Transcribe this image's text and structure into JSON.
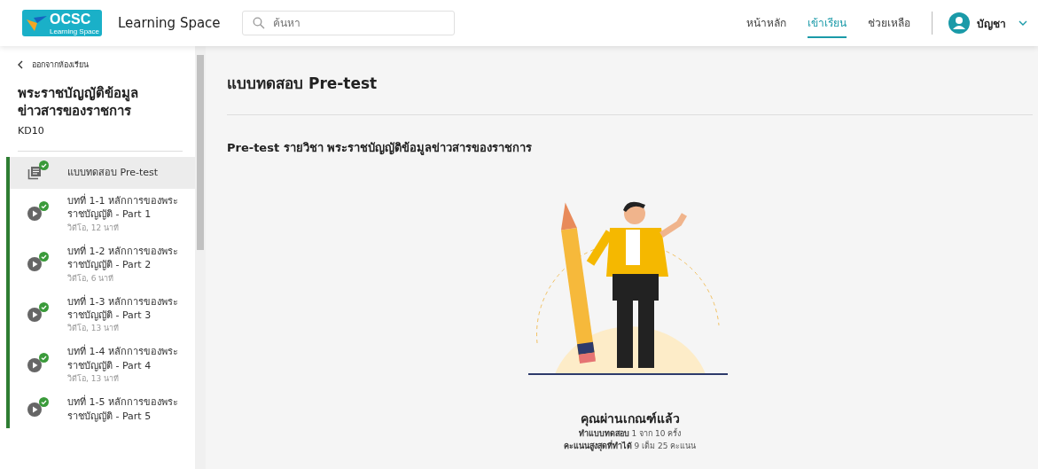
{
  "header": {
    "logo": {
      "title": "OCSC",
      "subtitle": "Learning Space"
    },
    "app_name": "Learning Space",
    "search": {
      "placeholder": "ค้นหา"
    },
    "nav": [
      {
        "label": "หน้าหลัก",
        "selected": false
      },
      {
        "label": "เข้าเรียน",
        "selected": true
      },
      {
        "label": "ช่วยเหลือ",
        "selected": false
      }
    ],
    "user": {
      "name": "บัญชา"
    }
  },
  "sidebar": {
    "back_link": "ออกจากห้องเรียน",
    "course_title": "พระราชบัญญัติข้อมูลข่าวสารของราชการ",
    "course_code": "KD10",
    "items": [
      {
        "kind": "quiz",
        "title": "แบบทดสอบ Pre-test",
        "completed": true,
        "selected": true
      },
      {
        "kind": "video",
        "title": "บทที่ 1-1 หลักการของพระราชบัญญัติ - Part 1",
        "meta": "วิดีโอ, 12 นาที",
        "completed": true,
        "selected": false
      },
      {
        "kind": "video",
        "title": "บทที่ 1-2 หลักการของพระราชบัญญัติ - Part 2",
        "meta": "วิดีโอ, 6 นาที",
        "completed": true,
        "selected": false
      },
      {
        "kind": "video",
        "title": "บทที่ 1-3 หลักการของพระราชบัญญัติ - Part 3",
        "meta": "วิดีโอ, 13 นาที",
        "completed": true,
        "selected": false
      },
      {
        "kind": "video",
        "title": "บทที่ 1-4 หลักการของพระราชบัญญัติ - Part 4",
        "meta": "วิดีโอ, 13 นาที",
        "completed": true,
        "selected": false
      },
      {
        "kind": "video",
        "title": "บทที่ 1-5 หลักการของพระราชบัญญัติ - Part 5",
        "completed": true,
        "selected": false
      }
    ]
  },
  "content": {
    "title": "แบบทดสอบ Pre-test",
    "subtitle": "Pre-test รายวิชา พระราชบัญญัติข้อมูลข่าวสารของราชการ",
    "result": "คุณผ่านเกณฑ์แล้ว",
    "stats": [
      "**ทำแบบทดสอบ** 1 จาก 10 ครั้ง",
      "**คะแนนสูงสุดที่ทำได้** 9 เต็ม 25 คะแนน"
    ]
  }
}
